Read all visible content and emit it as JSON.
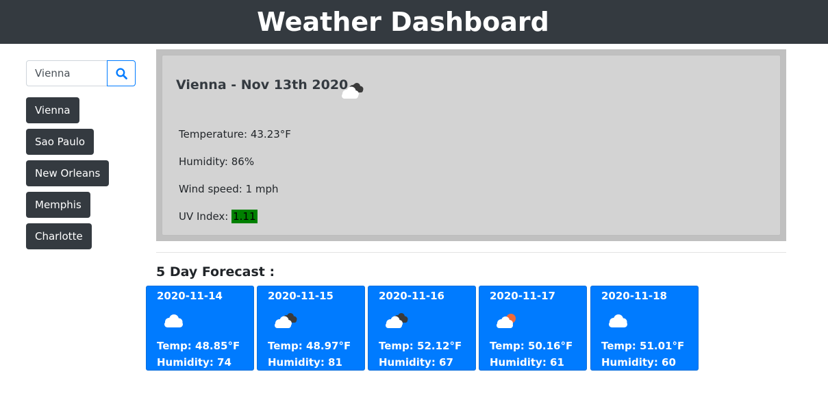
{
  "header": {
    "title": "Weather Dashboard"
  },
  "search": {
    "value": "Vienna",
    "button_icon": "search-icon"
  },
  "history": [
    "Vienna",
    "Sao Paulo",
    "New Orleans",
    "Memphis",
    "Charlotte"
  ],
  "current": {
    "title": "Vienna - Nov 13th 2020 -",
    "icon": "broken-clouds-icon",
    "temperature": "Temperature: 43.23°F",
    "humidity": "Humidity: 86%",
    "wind": "Wind speed: 1 mph",
    "uv_label": "UV Index: ",
    "uv_value": "1.11",
    "uv_color": "#008000"
  },
  "forecast_heading": "5 Day Forecast :",
  "forecast": [
    {
      "date": "2020-11-14",
      "icon": "few-clouds-icon",
      "temp": "Temp: 48.85°F",
      "humidity": "Humidity: 74"
    },
    {
      "date": "2020-11-15",
      "icon": "broken-clouds-icon",
      "temp": "Temp: 48.97°F",
      "humidity": "Humidity: 81"
    },
    {
      "date": "2020-11-16",
      "icon": "broken-clouds-icon",
      "temp": "Temp: 52.12°F",
      "humidity": "Humidity: 67"
    },
    {
      "date": "2020-11-17",
      "icon": "partly-cloudy-sun-icon",
      "temp": "Temp: 50.16°F",
      "humidity": "Humidity: 61"
    },
    {
      "date": "2020-11-18",
      "icon": "few-clouds-icon",
      "temp": "Temp: 51.01°F",
      "humidity": "Humidity: 60"
    }
  ],
  "colors": {
    "header_bg": "#343a40",
    "accent": "#007bff",
    "card_bg": "#d3d3d3"
  }
}
